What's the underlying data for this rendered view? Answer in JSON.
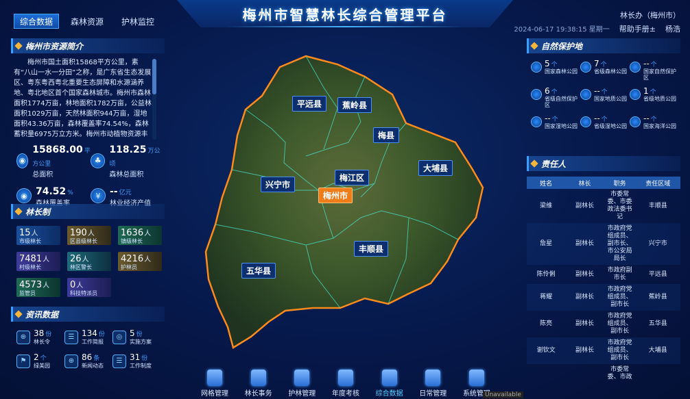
{
  "header": {
    "title": "梅州市智慧林长综合管理平台",
    "tabs": [
      "综合数据",
      "森林资源",
      "护林监控"
    ],
    "user": "林长办（梅州市）",
    "datetime": "2024-06-17  19:38:15  星期一",
    "help": "帮助手册±",
    "username": "杨浩"
  },
  "intro": {
    "title": "梅州市资源简介",
    "text": "梅州市国土面积15868平方公里，素有“八山一水一分田”之称，是广东省生态发展区、粤东粤西粤北重要生态屏障和水源涵养地、粤北地区首个国家森林城市。梅州市森林面积1774万亩，林地面积1782万亩，公益林面积1029万亩，天然林面积944万亩，湿地面积43.36万亩，森林覆盖率74.54%，森林蓄积量6975万立方米。梅州市动植物资源丰富，",
    "stats": [
      {
        "icon": "map-pin-icon",
        "value": "15868.00",
        "unit": "平方公里",
        "label": "总面积"
      },
      {
        "icon": "tree-icon",
        "value": "118.25",
        "unit": "万公顷",
        "label": "森林总面积"
      },
      {
        "icon": "map-pin-icon",
        "value": "74.52",
        "unit": "%",
        "label": "森林覆盖率"
      },
      {
        "icon": "money-icon",
        "value": "--",
        "unit": "亿元",
        "label": "林业经济产值"
      }
    ]
  },
  "chief": {
    "title": "林长制",
    "cards": [
      {
        "value": "15",
        "unit": "人",
        "label": "市级林长",
        "color": "blue"
      },
      {
        "value": "190",
        "unit": "人",
        "label": "区县级林长",
        "color": "tan"
      },
      {
        "value": "1636",
        "unit": "人",
        "label": "镇级林长",
        "color": "green"
      },
      {
        "value": "7481",
        "unit": "人",
        "label": "村级林长",
        "color": "purple"
      },
      {
        "value": "26",
        "unit": "人",
        "label": "林区警长",
        "color": "teal"
      },
      {
        "value": "4216",
        "unit": "人",
        "label": "护林员",
        "color": "tan"
      },
      {
        "value": "4573",
        "unit": "人",
        "label": "监管员",
        "color": "green"
      },
      {
        "value": "0",
        "unit": "人",
        "label": "科技特派员",
        "color": "purple"
      }
    ]
  },
  "news": {
    "title": "资讯数据",
    "items": [
      {
        "icon": "globe-icon",
        "value": "38",
        "unit": "份",
        "label": "林长令"
      },
      {
        "icon": "document-icon",
        "value": "134",
        "unit": "份",
        "label": "工作简报"
      },
      {
        "icon": "pin-icon",
        "value": "5",
        "unit": "份",
        "label": "实施方案"
      },
      {
        "icon": "flag-icon",
        "value": "2",
        "unit": "个",
        "label": "绿美园"
      },
      {
        "icon": "globe-icon",
        "value": "86",
        "unit": "条",
        "label": "新闻动态"
      },
      {
        "icon": "document-icon",
        "value": "31",
        "unit": "份",
        "label": "工作制度"
      }
    ]
  },
  "map": {
    "counties": [
      {
        "name": "平远县",
        "key": "pingyuan"
      },
      {
        "name": "蕉岭县",
        "key": "jiaoling"
      },
      {
        "name": "梅县",
        "key": "meixian"
      },
      {
        "name": "大埔县",
        "key": "dabu"
      },
      {
        "name": "梅江区",
        "key": "meijiang"
      },
      {
        "name": "兴宁市",
        "key": "xingning"
      },
      {
        "name": "梅州市",
        "key": "meizhou"
      },
      {
        "name": "丰顺县",
        "key": "fengshun"
      },
      {
        "name": "五华县",
        "key": "wuhua"
      }
    ]
  },
  "nav": {
    "items": [
      "网格管理",
      "林长事务",
      "护林管理",
      "年度考核",
      "综合数据",
      "日常管理",
      "系统管理"
    ],
    "active": "综合数据",
    "unavailable": "Unavailable"
  },
  "nature": {
    "title": "自然保护地",
    "items": [
      {
        "value": "5",
        "unit": "个",
        "label": "国家森林公园"
      },
      {
        "value": "7",
        "unit": "个",
        "label": "省级森林公园"
      },
      {
        "value": "--",
        "unit": "个",
        "label": "国家自然保护区"
      },
      {
        "value": "6",
        "unit": "个",
        "label": "省级自然保护区"
      },
      {
        "value": "--",
        "unit": "个",
        "label": "国家地质公园"
      },
      {
        "value": "1",
        "unit": "个",
        "label": "省级地质公园"
      },
      {
        "value": "--",
        "unit": "个",
        "label": "国家湿地公园"
      },
      {
        "value": "--",
        "unit": "个",
        "label": "省级湿地公园"
      },
      {
        "value": "--",
        "unit": "个",
        "label": "国家海洋公园"
      }
    ]
  },
  "responsible": {
    "title": "责任人",
    "columns": [
      "姓名",
      "林长",
      "职务",
      "责任区域"
    ],
    "rows": [
      [
        "梁维",
        "副林长",
        "市委常委、市委政法委书记",
        "丰顺县"
      ],
      [
        "詹星",
        "副林长",
        "市政府党组成员、副市长、市公安局局长",
        "兴宁市"
      ],
      [
        "陈伶俐",
        "副林长",
        "市政府副市长",
        "平远县"
      ],
      [
        "蒋耀",
        "副林长",
        "市政府党组成员、副市长",
        "蕉岭县"
      ],
      [
        "陈亮",
        "副林长",
        "市政府党组成员、副市长",
        "五华县"
      ],
      [
        "谢钦文",
        "副林长",
        "市政府党组成员、副市长",
        "大埔县"
      ],
      [
        "",
        "",
        "市委常委、市政",
        ""
      ]
    ]
  }
}
